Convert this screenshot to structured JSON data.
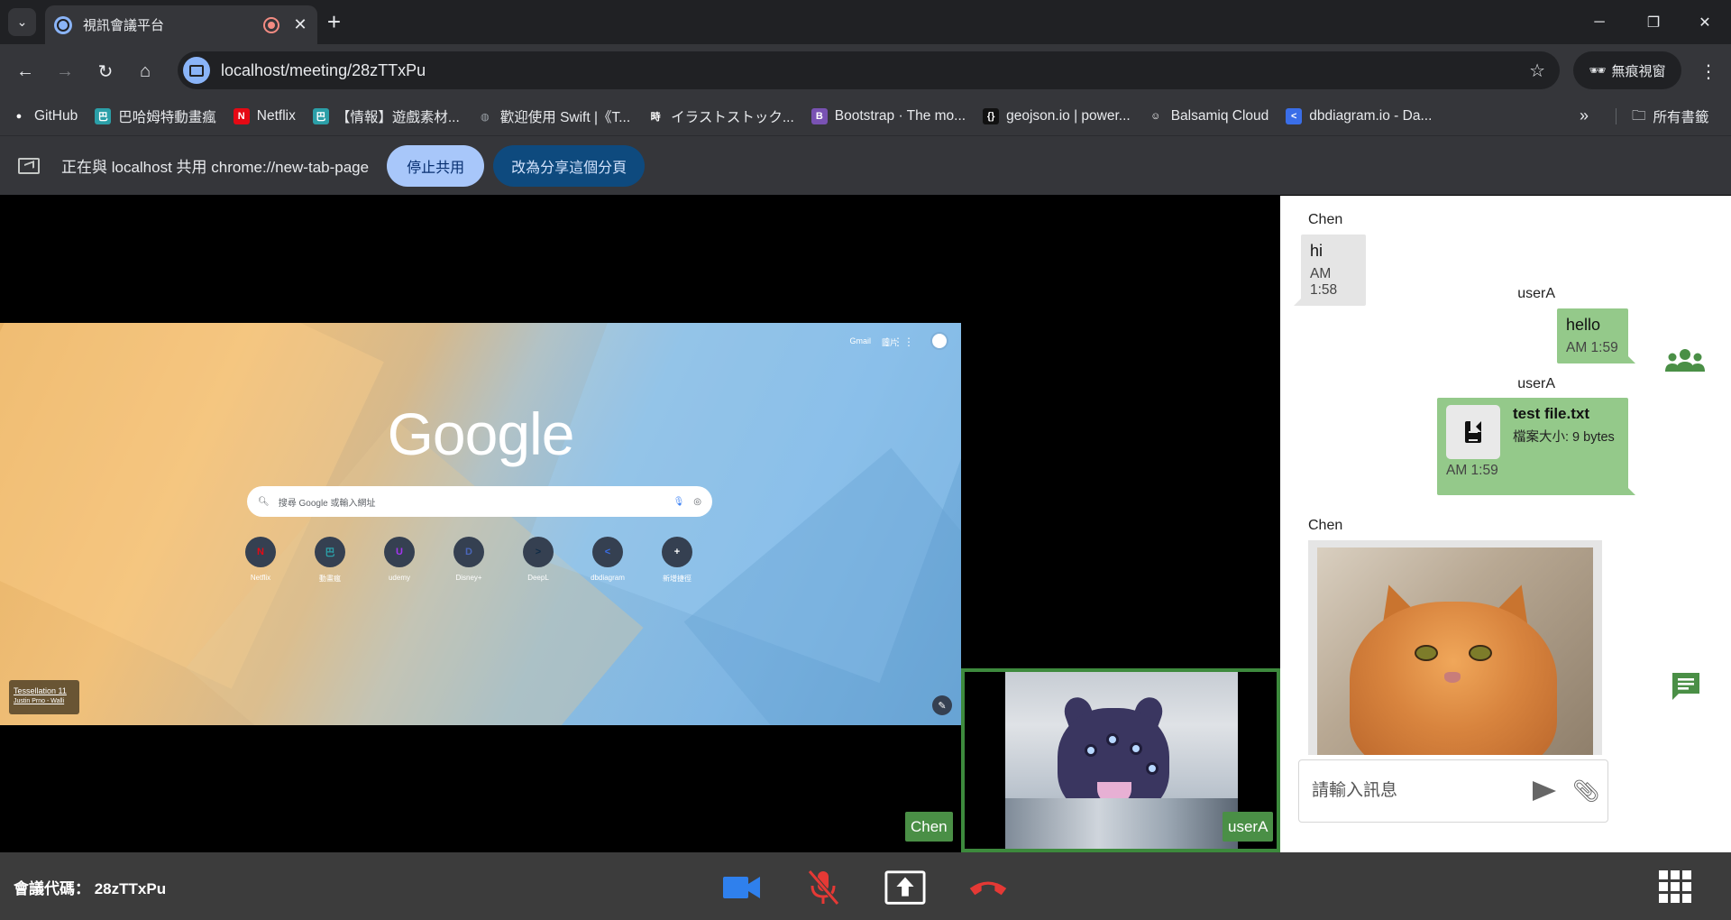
{
  "browser": {
    "tab_title": "視訊會議平台",
    "url": "localhost/meeting/28zTTxPu",
    "profile_label": "無痕視窗",
    "bookmarks": [
      {
        "label": "GitHub",
        "icon": "github-icon",
        "color": "#ffffff"
      },
      {
        "label": "巴哈姆特動畫瘋",
        "icon": "bahamut-icon",
        "color": "#2b9fa8"
      },
      {
        "label": "Netflix",
        "icon": "netflix-icon",
        "color": "#e50914"
      },
      {
        "label": "【情報】遊戲素材...",
        "icon": "bahamut-icon",
        "color": "#2b9fa8"
      },
      {
        "label": "歡迎使用 Swift |《T...",
        "icon": "globe-icon",
        "color": "#9aa0a6"
      },
      {
        "label": "イラストストック...",
        "icon": "jiji-icon",
        "color": "#ffffff"
      },
      {
        "label": "Bootstrap · The mo...",
        "icon": "bootstrap-icon",
        "color": "#7952b3"
      },
      {
        "label": "geojson.io | power...",
        "icon": "geojson-icon",
        "color": "#111111"
      },
      {
        "label": "Balsamiq Cloud",
        "icon": "balsamiq-icon",
        "color": "#ffffff"
      },
      {
        "label": "dbdiagram.io - Da...",
        "icon": "dbdiagram-icon",
        "color": "#3a6ee8"
      }
    ],
    "all_bookmarks_label": "所有書籤"
  },
  "sharebar": {
    "text": "正在與 localhost 共用 chrome://new-tab-page",
    "stop_label": "停止共用",
    "switch_label": "改為分享這個分頁"
  },
  "shared_screen": {
    "logo_text": "Google",
    "top_links": [
      "Gmail",
      "圖片"
    ],
    "search_placeholder": "搜尋 Google 或輸入網址",
    "shortcuts": [
      {
        "label": "Netflix",
        "glyph": "N",
        "color": "#e50914"
      },
      {
        "label": "動畫瘋",
        "glyph": "巴",
        "color": "#2b9fa8"
      },
      {
        "label": "udemy",
        "glyph": "U",
        "color": "#a435f0"
      },
      {
        "label": "Disney+",
        "glyph": "D",
        "color": "#4a66b8"
      },
      {
        "label": "DeepL",
        "glyph": ">",
        "color": "#0f2b46"
      },
      {
        "label": "dbdiagram",
        "glyph": "<",
        "color": "#3a6ee8"
      },
      {
        "label": "新增捷徑",
        "glyph": "+",
        "color": "#354051"
      }
    ],
    "credit_title": "Tessellation 11",
    "credit_author": "Justin Prno - Walli"
  },
  "participants": {
    "presenter_name": "Chen",
    "self_name": "userA"
  },
  "chat": {
    "messages": [
      {
        "sender": "Chen",
        "text": "hi",
        "time": "AM 1:58"
      },
      {
        "sender": "userA",
        "text": "hello",
        "time": "AM 1:59"
      },
      {
        "sender": "userA",
        "file_name": "test file.txt",
        "file_size": "檔案大小: 9 bytes",
        "time": "AM 1:59"
      },
      {
        "sender": "Chen",
        "image": "orange-cat-photo"
      }
    ],
    "input_placeholder": "請輸入訊息"
  },
  "controls": {
    "meeting_code_label": "會議代碼： 28zTTxPu",
    "camera_color": "#2f80ed",
    "mic_off_color": "#e53935",
    "hangup_color": "#e53935",
    "accent_green": "#4a8f46"
  }
}
